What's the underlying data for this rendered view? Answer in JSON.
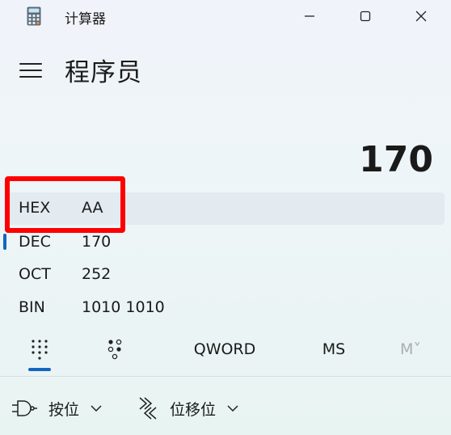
{
  "window": {
    "title": "计算器",
    "minimize_icon": "minimize-icon",
    "maximize_icon": "maximize-icon",
    "close_icon": "close-icon"
  },
  "header": {
    "menu_icon": "hamburger-icon",
    "mode": "程序员"
  },
  "display": {
    "value": "170"
  },
  "radix": [
    {
      "label": "HEX",
      "value": "AA"
    },
    {
      "label": "DEC",
      "value": "170"
    },
    {
      "label": "OCT",
      "value": "252"
    },
    {
      "label": "BIN",
      "value": "1010 1010"
    }
  ],
  "tabs": {
    "keypad_icon": "keypad-icon",
    "bits_icon": "bit-toggle-icon",
    "word_size": "QWORD",
    "memory_store": "MS",
    "memory_menu": "M˅"
  },
  "bottom": {
    "bitwise_label": "按位",
    "bitshift_label": "位移位"
  },
  "colors": {
    "accent": "#1565c0",
    "highlight_box": "#ff0000"
  }
}
